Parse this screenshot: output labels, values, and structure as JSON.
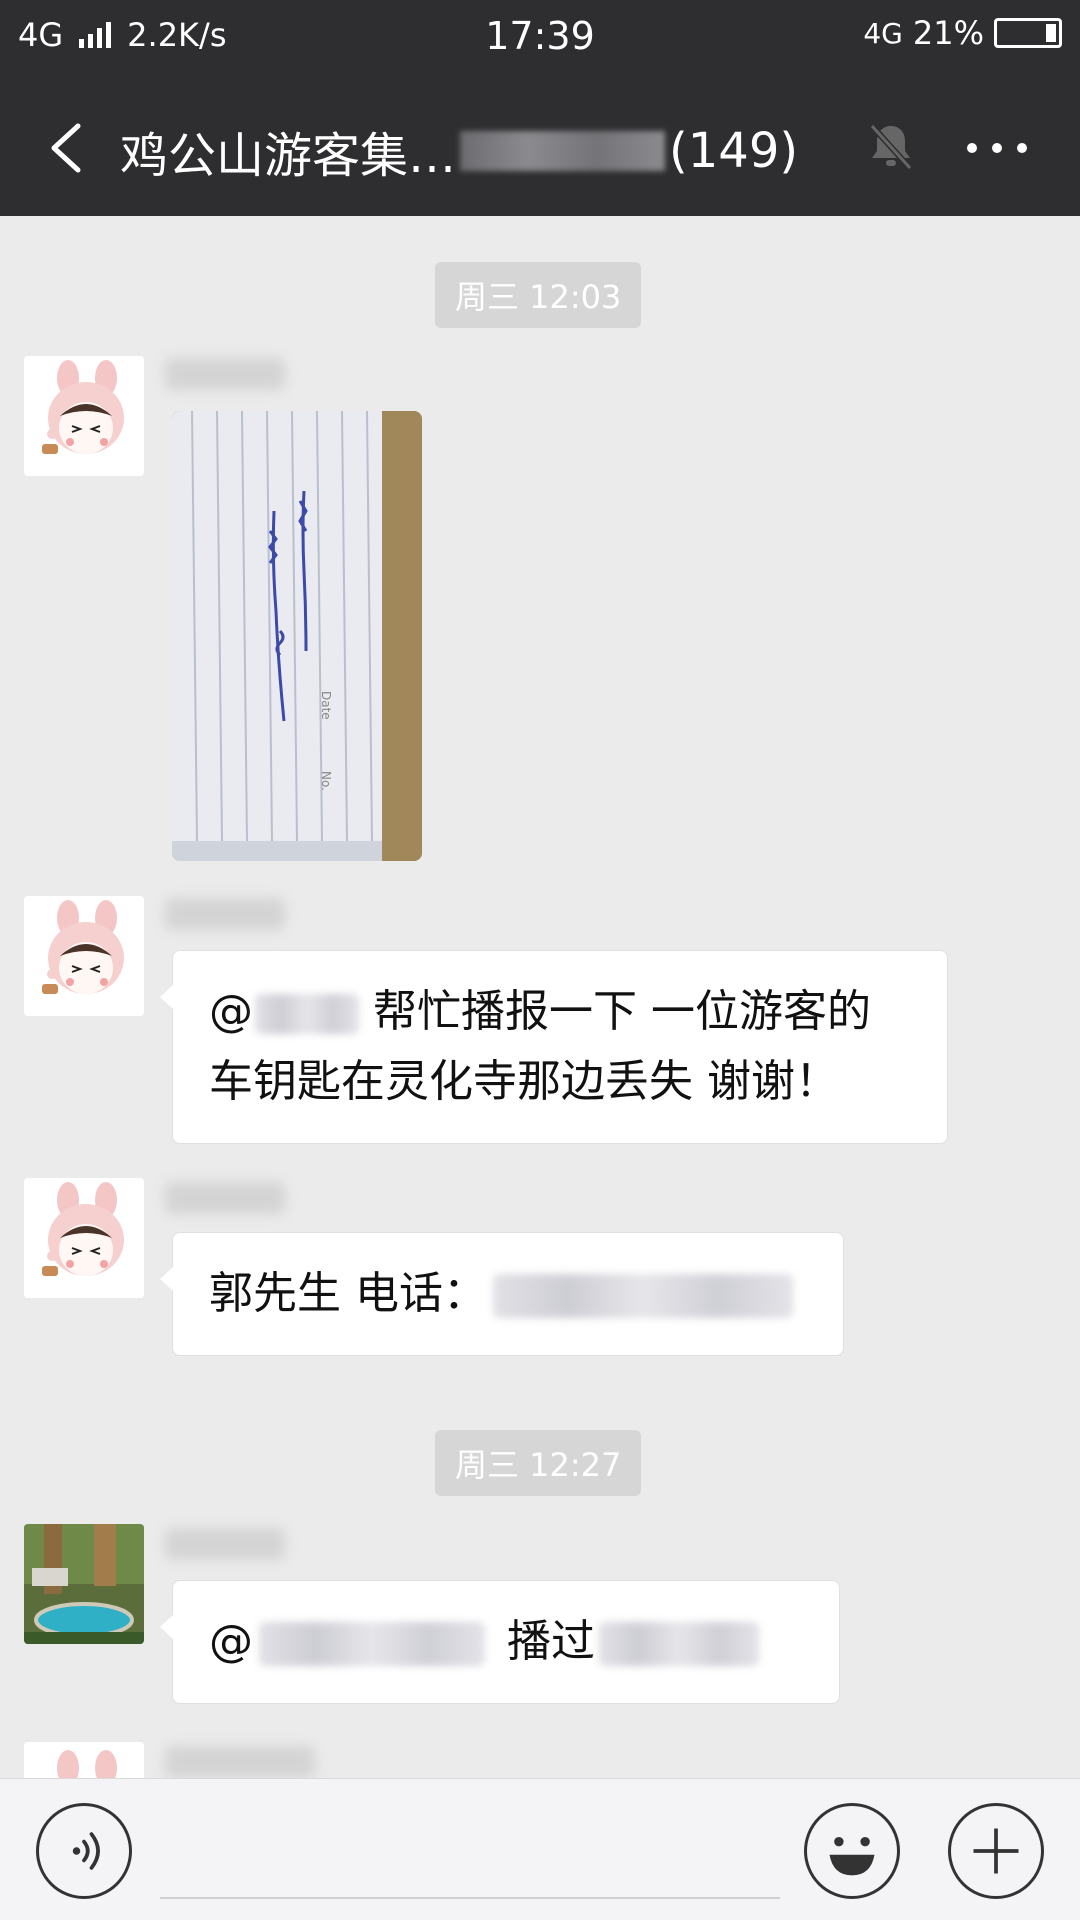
{
  "status_bar": {
    "network_left": "4G",
    "speed": "2.2K/s",
    "time": "17:39",
    "network_right": "4G",
    "battery": "21%",
    "battery_level": 0.21
  },
  "header": {
    "title_prefix": "鸡公山游客集…",
    "member_count": "(149)"
  },
  "messages": {
    "time1": "周三 12:03",
    "msg2_at": "@",
    "msg2_text_line1": "帮忙播报一下 一位游客的",
    "msg2_text_line2": "车钥匙在灵化寺那边丢失 谢谢！",
    "msg3_text": "郭先生 电话：",
    "time2": "周三 12:27",
    "msg4_at": "@",
    "msg4_text": "播过"
  },
  "icons": {
    "back": "back-arrow-icon",
    "mute": "bell-mute-icon",
    "more": "more-icon",
    "voice": "voice-icon",
    "emoji": "emoji-icon",
    "plus": "plus-icon"
  }
}
